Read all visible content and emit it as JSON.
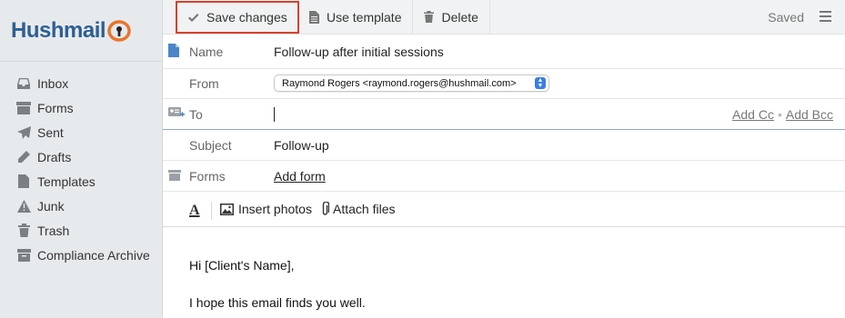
{
  "logo": {
    "text_before": "Hushmail",
    "text_after": ""
  },
  "toolbar": {
    "save_label": "Save changes",
    "template_label": "Use template",
    "delete_label": "Delete",
    "status": "Saved"
  },
  "sidebar": {
    "items": [
      {
        "label": "Inbox",
        "icon": "inbox-icon"
      },
      {
        "label": "Forms",
        "icon": "forms-icon"
      },
      {
        "label": "Sent",
        "icon": "sent-icon"
      },
      {
        "label": "Drafts",
        "icon": "drafts-icon"
      },
      {
        "label": "Templates",
        "icon": "templates-icon"
      },
      {
        "label": "Junk",
        "icon": "junk-icon"
      },
      {
        "label": "Trash",
        "icon": "trash-icon"
      },
      {
        "label": "Compliance Archive",
        "icon": "archive-icon"
      }
    ]
  },
  "form": {
    "name_label": "Name",
    "name_value": "Follow-up after initial sessions",
    "from_label": "From",
    "from_value": "Raymond Rogers <raymond.rogers@hushmail.com>",
    "to_label": "To",
    "to_value": "",
    "add_cc": "Add Cc",
    "add_bcc": "Add Bcc",
    "subject_label": "Subject",
    "subject_value": "Follow-up",
    "forms_label": "Forms",
    "add_form": "Add form"
  },
  "editor": {
    "insert_photos": "Insert photos",
    "attach_files": "Attach files"
  },
  "body": {
    "line1": "Hi [Client's Name],",
    "line2": "I hope this email finds you well."
  },
  "colors": {
    "accent_blue": "#2d5f95",
    "highlight_red": "#d9402c",
    "link_blue": "#2a6bb0"
  }
}
